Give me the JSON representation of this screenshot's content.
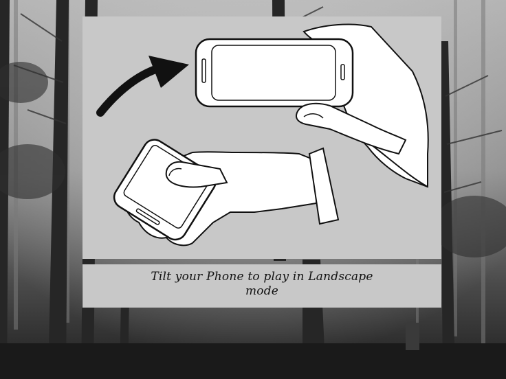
{
  "overlay": {
    "message": "Tilt your Phone to play in Landscape mode"
  },
  "colors": {
    "panel": "#c8c8c8",
    "ink": "#111111",
    "phone_screen": "#ffffff",
    "forest_light": "#9a9a9a",
    "forest_dark": "#1c1c1c"
  },
  "icons": {
    "arrow": "rotate-arrow-icon",
    "landscape_phone": "landscape-phone-icon",
    "portrait_phone": "portrait-phone-icon"
  }
}
